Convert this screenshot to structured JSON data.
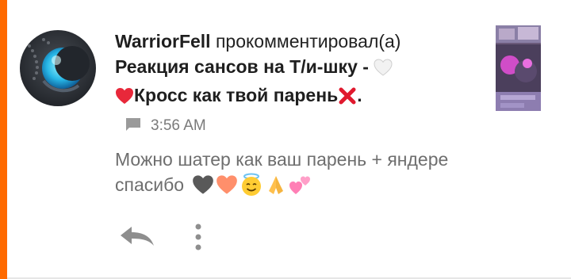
{
  "colors": {
    "accent": "#ff6a00",
    "username": "#1f1f1f",
    "body_text": "#6e6e6e",
    "meta_text": "#7a7a7a"
  },
  "notification": {
    "username": "WarriorFell",
    "action": "прокомментировал(а)",
    "story_title_part1": "Реакция сансов на Т/и-шку -",
    "story_title_part2": "Кросс как твой парень",
    "story_title_end": "."
  },
  "meta": {
    "icon": "comment-icon",
    "time": "3:56 AM"
  },
  "comment": {
    "text": "Можно шатер как ваш парень + яндере спасибо",
    "emojis": [
      "black-heart",
      "orange-heart",
      "smiling-face-with-halo",
      "folded-hands",
      "two-hearts"
    ]
  },
  "actions": {
    "reply_icon": "reply-icon",
    "more_icon": "more-vertical-icon"
  }
}
